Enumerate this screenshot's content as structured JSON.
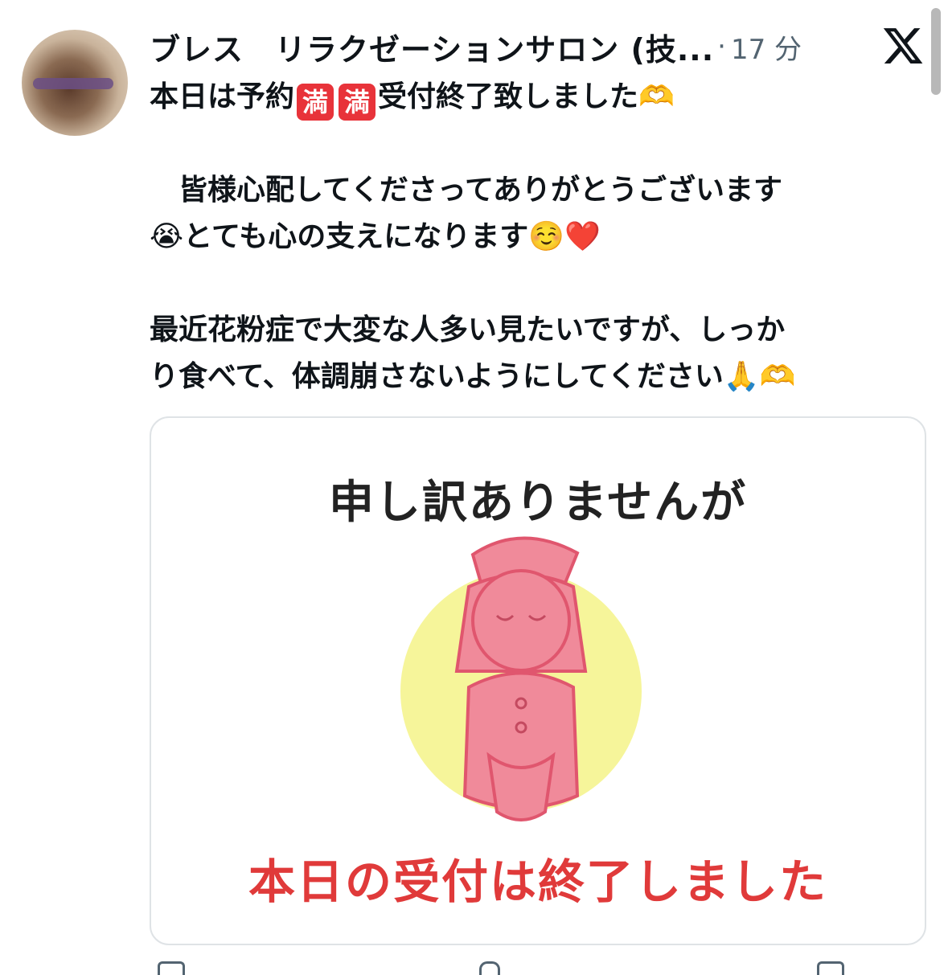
{
  "post": {
    "author_name": "ブレス　リラクゼーションサロン (技...",
    "separator": "·",
    "time": "17 分",
    "line1_before": "本日は予約",
    "line1_badge1": "満",
    "line1_badge2": "満",
    "line1_after": "受付終了致しました",
    "line1_emoji": "🫶",
    "para2_line1": "　皆様心配してくださってありがとうございます",
    "para2_emoji_cry": "😭",
    "para2_line2": "とても心の支えになります",
    "para2_emoji_smile": "☺️",
    "para2_emoji_heart": "❤️",
    "para3_line1": "最近花粉症で大変な人多い見たいですが、しっか",
    "para3_line2": "り食べて、体調崩さないようにしてください",
    "para3_emoji_pray": "🙏",
    "para3_emoji_heart": "🫶"
  },
  "image_card": {
    "title": "申し訳ありませんが",
    "caption": "本日の受付は終了しました"
  },
  "colors": {
    "text": "#0f1419",
    "muted": "#536471",
    "badge_red": "#e8333a",
    "caption_red": "#e03a3a",
    "figure_pink": "#f08a9a",
    "halo_yellow": "#f6f59a"
  },
  "icons": [
    "x-logo-icon",
    "avatar-image",
    "reply-icon",
    "repost-icon",
    "like-icon",
    "share-icon"
  ]
}
